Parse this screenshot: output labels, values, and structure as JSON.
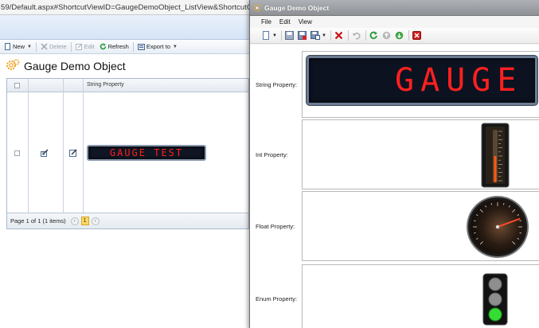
{
  "address_bar": {
    "url": "59/Default.aspx#ShortcutViewID=GaugeDemoObject_ListView&ShortcutC"
  },
  "list_toolbar": {
    "new_label": "New",
    "delete_label": "Delete",
    "edit_label": "Edit",
    "refresh_label": "Refresh",
    "export_label": "Export to"
  },
  "list_view": {
    "title": "Gauge Demo Object",
    "column_header": "String Property",
    "row_gauge_text": "GAUGE TEST",
    "pager_text": "Page 1 of 1 (1 items)",
    "current_page": "1",
    "prev_glyph": "‹",
    "next_glyph": "›"
  },
  "detail_window": {
    "title": "Gauge Demo Object",
    "menu": [
      "File",
      "Edit",
      "View"
    ]
  },
  "detail_fields": {
    "string_label": "String Property:",
    "string_value": "GAUGE",
    "int_label": "Int Property:",
    "float_label": "Float Property:",
    "enum_label": "Enum Property:"
  },
  "gauges": {
    "int_level_fraction": 0.5,
    "float_needle_angle_deg": 70,
    "enum_lit_light": "bottom",
    "lit_color": "#33dd33",
    "lcd_text_color": "#ff2020"
  },
  "colors": {
    "accent": "#d6e4f5",
    "detail_titlebar": "#9da1a6",
    "delete_red": "#cc1111"
  }
}
